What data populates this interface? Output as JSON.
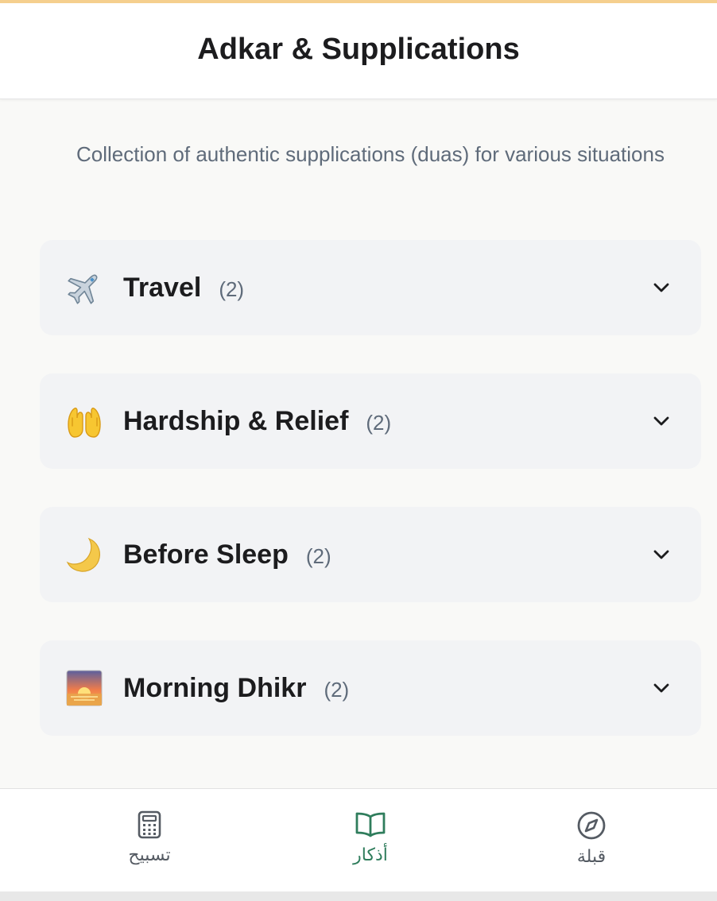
{
  "header": {
    "title": "Adkar & Supplications"
  },
  "subtitle": "Collection of authentic supplications (duas) for various situations",
  "categories": [
    {
      "title": "Travel",
      "count": "(2)",
      "icon": "airplane-icon"
    },
    {
      "title": "Hardship & Relief",
      "count": "(2)",
      "icon": "raised-hands-icon"
    },
    {
      "title": "Before Sleep",
      "count": "(2)",
      "icon": "crescent-moon-icon"
    },
    {
      "title": "Morning Dhikr",
      "count": "(2)",
      "icon": "sunrise-icon"
    }
  ],
  "nav": {
    "items": [
      {
        "label": "تسبيح",
        "icon": "calculator-icon",
        "active": false
      },
      {
        "label": "أذكار",
        "icon": "book-open-icon",
        "active": true
      },
      {
        "label": "قبلة",
        "icon": "compass-icon",
        "active": false
      }
    ]
  },
  "colors": {
    "accent_bar": "#f5cf8e",
    "active_nav": "#2f7d5c",
    "card_bg": "#f2f3f5",
    "page_bg": "#f9f9f7"
  }
}
